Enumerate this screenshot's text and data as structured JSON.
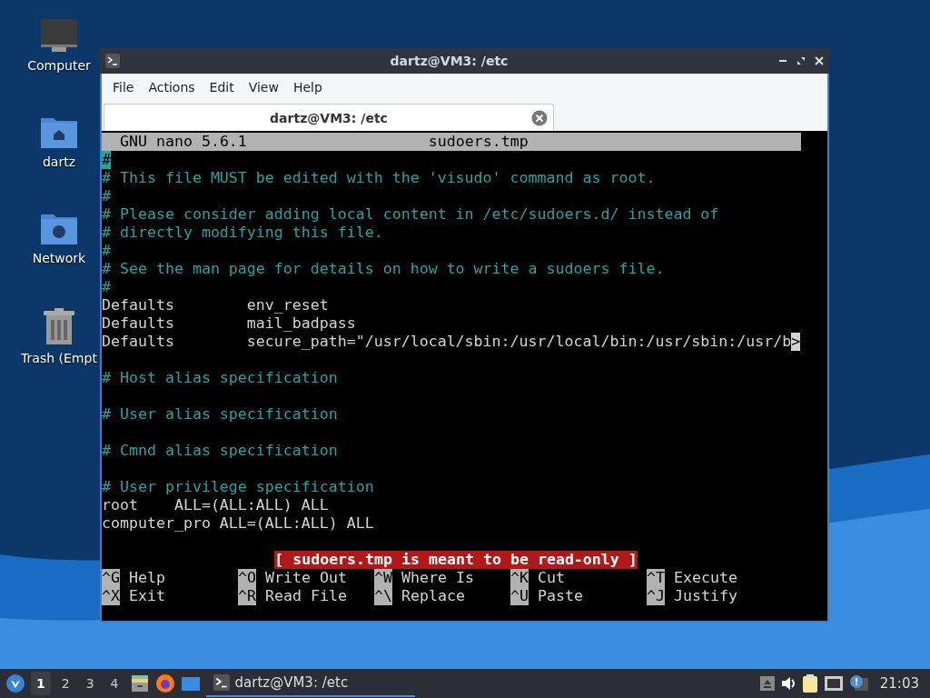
{
  "desktop_icons": [
    {
      "kind": "computer",
      "label": "Computer"
    },
    {
      "kind": "home",
      "label": "dartz"
    },
    {
      "kind": "network",
      "label": "Network"
    },
    {
      "kind": "trash",
      "label": "Trash (Empt"
    }
  ],
  "window": {
    "title": "dartz@VM3: /etc",
    "menu": [
      "File",
      "Actions",
      "Edit",
      "View",
      "Help"
    ],
    "tabs": [
      {
        "label": "dartz@VM3: /etc",
        "selected": true
      }
    ],
    "nano": {
      "version": "GNU nano 5.6.1",
      "filename": "sudoers.tmp",
      "lines": [
        {
          "kind": "comment",
          "text": "#",
          "cursor": true
        },
        {
          "kind": "comment",
          "text": "# This file MUST be edited with the 'visudo' command as root.",
          "cursor": false
        },
        {
          "kind": "comment",
          "text": "#",
          "cursor": false
        },
        {
          "kind": "comment",
          "text": "# Please consider adding local content in /etc/sudoers.d/ instead of",
          "cursor": false
        },
        {
          "kind": "comment",
          "text": "# directly modifying this file.",
          "cursor": false
        },
        {
          "kind": "comment",
          "text": "#",
          "cursor": false
        },
        {
          "kind": "comment",
          "text": "# See the man page for details on how to write a sudoers file.",
          "cursor": false
        },
        {
          "kind": "comment",
          "text": "#",
          "cursor": false
        },
        {
          "kind": "code",
          "text": "Defaults        env_reset",
          "cursor": false
        },
        {
          "kind": "code",
          "text": "Defaults        mail_badpass",
          "cursor": false
        },
        {
          "kind": "code",
          "text": "Defaults        secure_path=\"/usr/local/sbin:/usr/local/bin:/usr/sbin:/usr/b",
          "cursor": false,
          "overflow_mark": ">"
        },
        {
          "kind": "blank"
        },
        {
          "kind": "comment",
          "text": "# Host alias specification",
          "cursor": false
        },
        {
          "kind": "blank"
        },
        {
          "kind": "comment",
          "text": "# User alias specification",
          "cursor": false
        },
        {
          "kind": "blank"
        },
        {
          "kind": "comment",
          "text": "# Cmnd alias specification",
          "cursor": false
        },
        {
          "kind": "blank"
        },
        {
          "kind": "comment",
          "text": "# User privilege specification",
          "cursor": false
        },
        {
          "kind": "code",
          "text": "root    ALL=(ALL:ALL) ALL",
          "cursor": false
        },
        {
          "kind": "code",
          "text": "computer_pro ALL=(ALL:ALL) ALL",
          "cursor": false
        },
        {
          "kind": "blank"
        }
      ],
      "status": "[ sudoers.tmp is meant to be read-only ]",
      "shortcuts": [
        {
          "key": "^G",
          "label": "Help"
        },
        {
          "key": "^O",
          "label": "Write Out"
        },
        {
          "key": "^W",
          "label": "Where Is"
        },
        {
          "key": "^K",
          "label": "Cut"
        },
        {
          "key": "^T",
          "label": "Execute"
        },
        {
          "key": "^X",
          "label": "Exit"
        },
        {
          "key": "^R",
          "label": "Read File"
        },
        {
          "key": "^\\",
          "label": "Replace"
        },
        {
          "key": "^U",
          "label": "Paste"
        },
        {
          "key": "^J",
          "label": "Justify"
        }
      ]
    }
  },
  "taskbar": {
    "workspaces": [
      {
        "label": "1",
        "selected": true
      },
      {
        "label": "2",
        "selected": false
      },
      {
        "label": "3",
        "selected": false
      },
      {
        "label": "4",
        "selected": false
      }
    ],
    "tasks": [
      {
        "label": "dartz@VM3: /etc",
        "selected": true
      }
    ],
    "clock": "21:03"
  }
}
